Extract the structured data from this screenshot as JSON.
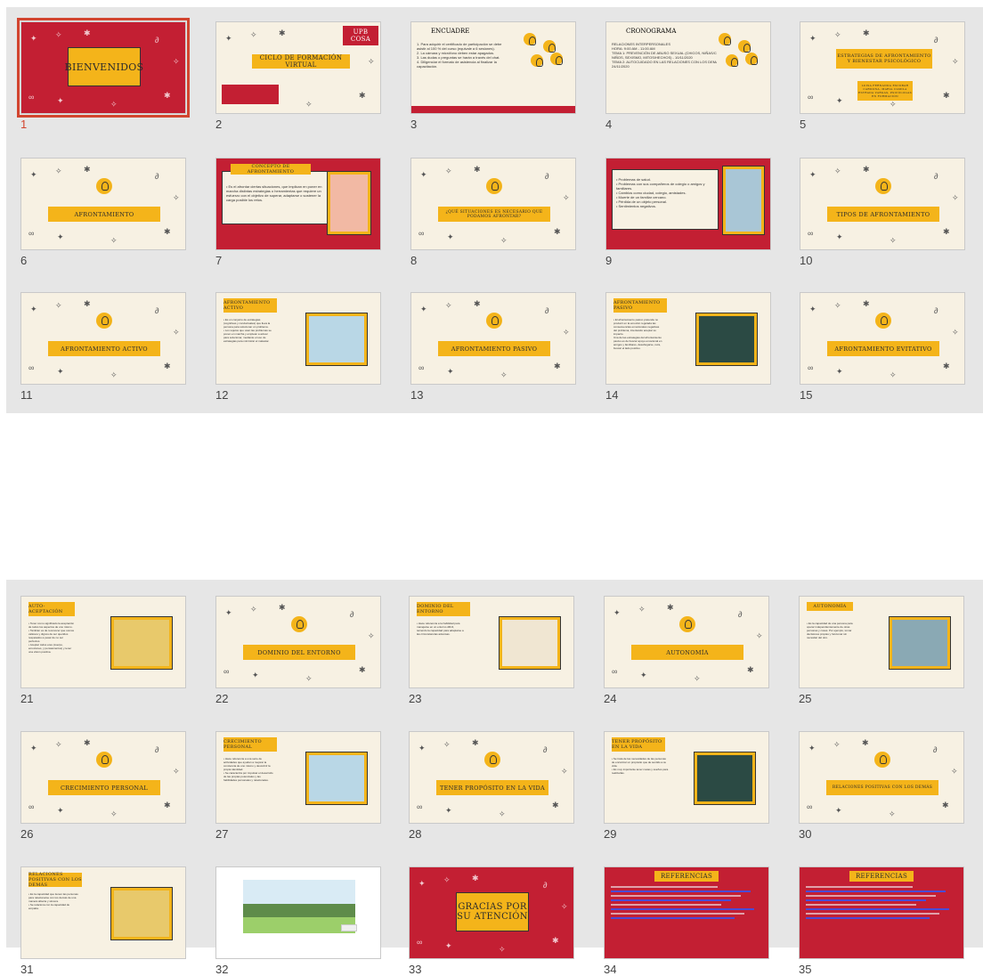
{
  "panel_a": {
    "slides": [
      {
        "num": "1",
        "kind": "title-red",
        "text": "BIENVENIDOS",
        "selected": true
      },
      {
        "num": "2",
        "kind": "banner",
        "text": "CICLO DE FORMACIÓN VIRTUAL",
        "logo": "UPB COSA"
      },
      {
        "num": "3",
        "kind": "list",
        "title": "ENCUADRE",
        "lines": [
          "1.  Para adquirir el certificado de participación se debe",
          "    asistir al 100 % del curso (equivale a 6 sesiones).",
          "2.  La cámara y micrófono deben estar apagados.",
          "3.  Las dudas o preguntas se harán a través del chat.",
          "4.  Diligenciar el formato de asistencia al finalizar la",
          "    capacitación."
        ]
      },
      {
        "num": "4",
        "kind": "list",
        "title": "CRONOGRAMA",
        "lines": [
          "RELACIONES INTERPERSONALES",
          "HORA: 9:00 AM - 11:00 AM",
          "TEMA 1: PREVENCIÓN DE ABUSO SEXUAL (CHICOS, NIÑAS/CHICOS",
          "NIÑOS, SEXISMO, MITOS/HECHOS) - 10/11/2020",
          "TEMA 2: AUTOCUIDADO EN LAS RELACIONES CON LOS DEMÁS.",
          "24/11/2020"
        ]
      },
      {
        "num": "5",
        "kind": "two-banner",
        "text": "ESTRATEGIAS DE AFRONTAMIENTO Y BIENESTAR PSICOLÓGICO",
        "sub": "LUISA FERNANDA ESCOBAR CARDONA, MARIA CAMILA ESTRADA VARGAS, PSICÓLOGAS EN FORMACIÓN"
      },
      {
        "num": "6",
        "kind": "bulb",
        "text": "AFRONTAMIENTO"
      },
      {
        "num": "7",
        "kind": "concept",
        "title": "CONCEPTO DE AFRONTAMIENTO",
        "lines": [
          "• Es el afrontar ciertas situaciones, que implican en poner en",
          "marcha distintas estrategias o herramientas que requiere un",
          "esfuerzo con el objetivo de superar, adaptarse o sostener la",
          "carga posible los retos."
        ]
      },
      {
        "num": "8",
        "kind": "bulb",
        "text": "¿QUÉ SITUACIONES ES NECESARIO QUE PODAMOS AFRONTAR?"
      },
      {
        "num": "9",
        "kind": "red-list",
        "lines": [
          "•  Problemas de salud.",
          "•  Problemas con sus compañeros de colegio o amigos y",
          "   familiares.",
          "•  Cambios como ciudad, colegio, amistades.",
          "•  Muerte de un familiar cercano.",
          "•  Pérdida de un objeto personal.",
          "•  Sentimientos negativos."
        ]
      },
      {
        "num": "10",
        "kind": "bulb",
        "text": "TIPOS DE AFRONTAMIENTO"
      },
      {
        "num": "11",
        "kind": "bulb",
        "text": "AFRONTAMIENTO ACTIVO"
      },
      {
        "num": "12",
        "kind": "tag-photo",
        "title": "AFRONTAMIENTO ACTIVO",
        "lines": [
          "•  Es un conjunto de estrategias",
          "   (cognitivas y conductuales) que lleva la",
          "   persona para solucionar un problema.",
          "•  Los sujetos que usan las problemas se",
          "   ponen en marcha y emplean a actuar",
          "   para solucionar, mediante el uso de",
          "   estrategias para minimizar el malestar."
        ]
      },
      {
        "num": "13",
        "kind": "bulb",
        "text": "AFRONTAMIENTO PASIVO"
      },
      {
        "num": "14",
        "kind": "tag-photo",
        "title": "AFRONTAMIENTO PASIVO",
        "lines": [
          "•  El afrontamiento pasivo pretende no",
          "   producir en la emoción regulada las",
          "   consecuencias emocionales negativas",
          "   del problema, intentando aceptar su",
          "   impacto.",
          "Una de las estrategias del afrontamiento",
          "pasivo es de buscar apoyo emocional en",
          "amigos y familiares, desahogarse, reza,",
          "buscar el lado positivo."
        ]
      },
      {
        "num": "15",
        "kind": "bulb",
        "text": "AFRONTAMIENTO EVITATIVO"
      }
    ]
  },
  "panel_b": {
    "slides": [
      {
        "num": "21",
        "kind": "tag-photo",
        "title": "AUTO-ACEPTACIÓN",
        "lines": [
          "•  Tener como significado la aceptación",
          "   de todos los aspectos de uno mismo.",
          "•  También es de reconocer que somos",
          "   valiosos y dignos de ser queridos",
          "   respetados a pesar de no ser",
          "   perfectos.",
          "•  Aceptar todos eres (cuerpo,",
          "   emociones, y pensamientos) y tener",
          "   una visión positiva."
        ]
      },
      {
        "num": "22",
        "kind": "bulb",
        "text": "DOMINIO DEL ENTORNO"
      },
      {
        "num": "23",
        "kind": "tag-photo",
        "title": "DOMINIO DEL ENTORNO",
        "lines": [
          "•  Hace referencia a la habilidad para",
          "   manejarse en un entorno difícil,",
          "   teniendo la capacidad para adaptarse a",
          "   las circunstancias adversas."
        ]
      },
      {
        "num": "24",
        "kind": "bulb",
        "text": "AUTONOMÍA"
      },
      {
        "num": "25",
        "kind": "tag-photo",
        "title": "AUTONOMÍA",
        "lines": [
          "•  Es la capacidad de una persona para",
          "   operar independientemente de otras",
          "   personas y cosas. Por ejemplo, tomar",
          "   decisiones propias y funcionar sin",
          "   necesitar del otro."
        ]
      },
      {
        "num": "26",
        "kind": "bulb",
        "text": "CRECIMIENTO PERSONAL"
      },
      {
        "num": "27",
        "kind": "tag-photo",
        "title": "CRECIMIENTO PERSONAL",
        "lines": [
          "•  Hace referencia a una serie de",
          "   actividades que ayudan a mejorar la",
          "   conciencia de uno mismo y descubrir la",
          "   propia identidad.",
          "•  Se caracteriza por impulsar el desarrollo",
          "   de las propias potenciales y las",
          "   habilidades personales y relacionales."
        ]
      },
      {
        "num": "28",
        "kind": "bulb",
        "text": "TENER PROPÓSITO EN LA VIDA"
      },
      {
        "num": "29",
        "kind": "tag-photo",
        "title": "TENER PROPÓSITO EN LA VIDA",
        "lines": [
          "•  Se trata de las necesidades de las personas",
          "   de encontrar un propósito que de sentido a su",
          "   vida.",
          "•  Es muy importante tener metas y sueños para",
          "   realizarlas."
        ]
      },
      {
        "num": "30",
        "kind": "bulb",
        "text": "RELACIONES POSITIVAS CON LOS DEMÁS"
      },
      {
        "num": "31",
        "kind": "tag-photo",
        "title": "RELACIONES POSITIVAS CON LOS DEMÁS",
        "lines": [
          "•  Es la capacidad que tienen las personas",
          "   para relacionarse con los demás de una",
          "   manera abierta y sincera.",
          "•  Se relaciona con la capacidad de",
          "   empatía."
        ]
      },
      {
        "num": "32",
        "kind": "video",
        "text": ""
      },
      {
        "num": "33",
        "kind": "title-red",
        "text": "GRACIAS POR SU ATENCIÓN"
      },
      {
        "num": "34",
        "kind": "refs",
        "title": "REFERENCIAS"
      },
      {
        "num": "35",
        "kind": "refs",
        "title": "REFERENCIAS"
      }
    ]
  },
  "colors": {
    "accent": "#d2452f",
    "red": "#c31f33",
    "yellow": "#f4b41a",
    "cream": "#f7f1e3",
    "panel": "#e6e6e6"
  }
}
